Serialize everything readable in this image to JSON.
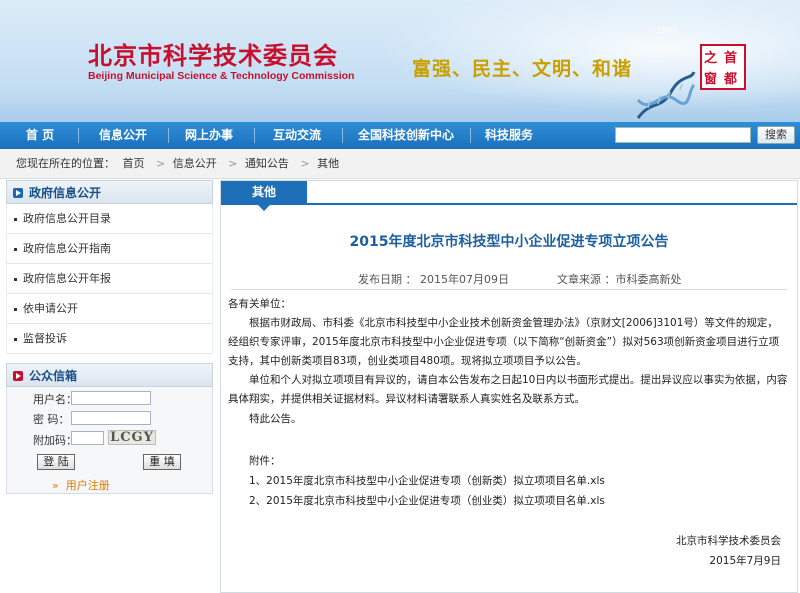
{
  "header": {
    "title": "北京市科学技术委员会",
    "subtitle": "Beijing Municipal Science & Technology Commission",
    "slogan": "富强、民主、文明、和谐",
    "dna_text": "DNA",
    "logo_chars": [
      "首",
      "都",
      "之",
      "窗"
    ]
  },
  "nav": {
    "items": [
      "首    页",
      "信息公开",
      "网上办事",
      "互动交流",
      "全国科技创新中心",
      "科技服务"
    ],
    "search_placeholder": "",
    "search_button": "搜索"
  },
  "breadcrumb": {
    "prefix": "您现在所在的位置：",
    "items": [
      "首页",
      "信息公开",
      "通知公告",
      "其他"
    ]
  },
  "sidebar": {
    "section_title": "政府信息公开",
    "items": [
      "政府信息公开目录",
      "政府信息公开指南",
      "政府信息公开年报",
      "依申请公开",
      "监督投诉"
    ]
  },
  "mailbox": {
    "title": "公众信箱",
    "username_label": "用户名：",
    "password_label": "密    码：",
    "captcha_label": "附加码：",
    "captcha_text": "LCGY",
    "login_button": "登 陆",
    "reset_button": "重 填",
    "register_link": "用户注册"
  },
  "article": {
    "tab": "其他",
    "title": "2015年度北京市科技型中小企业促进专项立项公告",
    "publish_date_label": "发布日期 ：",
    "publish_date": "2015年07月09日",
    "source_label": "文章来源 ：",
    "source": "市科委高新处",
    "salutation": "各有关单位：",
    "para1": "根据市财政局、市科委《北京市科技型中小企业技术创新资金管理办法》（京财文[2006]3101号）等文件的规定，经组织专家评审，2015年度北京市科技型中小企业促进专项（以下简称“创新资金”）拟对563项创新资金项目进行立项支持，其中创新类项目83项，创业类项目480项。现将拟立项项目予以公告。",
    "para2": "单位和个人对拟立项项目有异议的，请自本公告发布之日起10日内以书面形式提出。提出异议应以事实为依据，内容具体翔实，并提供相关证据材料。异议材料请署联系人真实姓名及联系方式。",
    "para3": "特此公告。",
    "attachments_label": "附件：",
    "attachment1": "1、2015年度北京市科技型中小企业促进专项（创新类）拟立项项目名单.xls",
    "attachment2": "2、2015年度北京市科技型中小企业促进专项（创业类）拟立项项目名单.xls",
    "signer": "北京市科学技术委员会",
    "sign_date": "2015年7月9日"
  }
}
